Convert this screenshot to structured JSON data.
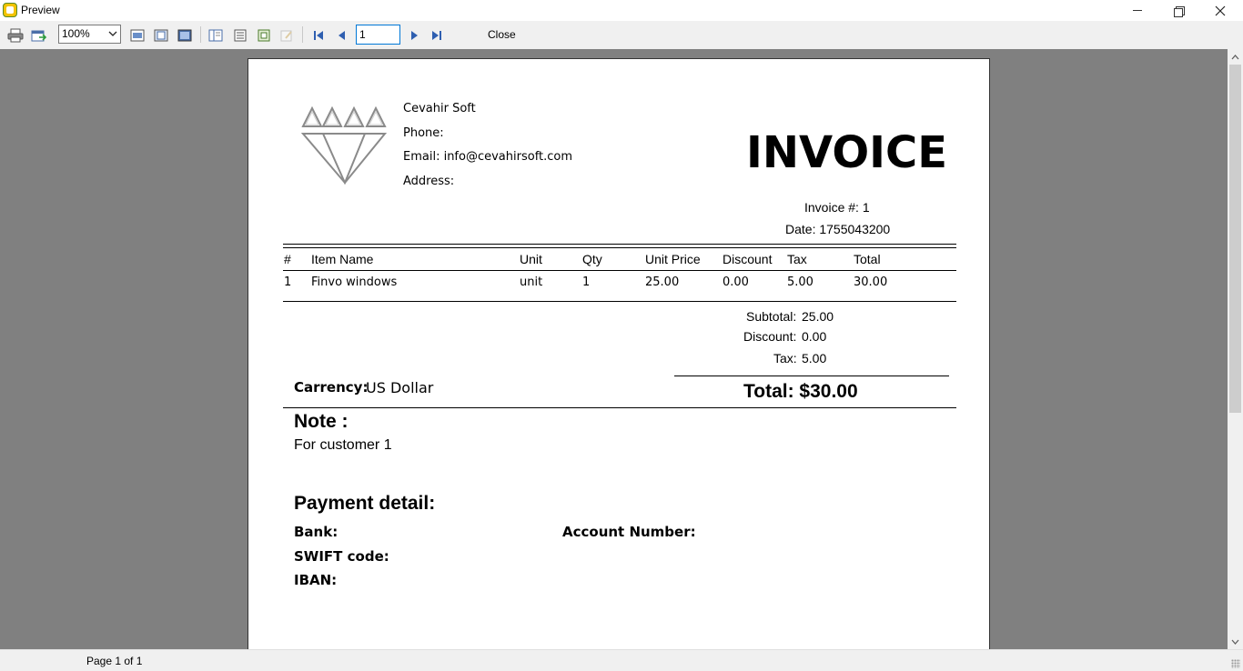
{
  "window": {
    "title": "Preview"
  },
  "toolbar": {
    "zoom_value": "100%",
    "page_value": "1",
    "close_label": "Close"
  },
  "status": {
    "page_info": "Page 1 of 1"
  },
  "invoice": {
    "company": {
      "name": "Cevahir Soft",
      "phone_line": "Phone:",
      "email_line": "Email: info@cevahirsoft.com",
      "address_line": "Address:"
    },
    "title": "INVOICE",
    "number_line": "Invoice #: 1",
    "date_line": "Date: 1755043200",
    "table": {
      "headers": [
        "#",
        "Item Name",
        "Unit",
        "Qty",
        "Unit Price",
        "Discount",
        "Tax",
        "Total"
      ],
      "rows": [
        [
          "1",
          "Finvo windows",
          "unit",
          "1",
          "25.00",
          "0.00",
          "5.00",
          "30.00"
        ]
      ]
    },
    "summary": {
      "subtotal_label": "Subtotal:",
      "subtotal_value": "25.00",
      "discount_label": "Discount:",
      "discount_value": "0.00",
      "tax_label": "Tax:",
      "tax_value": "5.00",
      "total_line": "Total: $30.00"
    },
    "currency": {
      "label": "Carrency:",
      "value": "US Dollar"
    },
    "note": {
      "title": "Note :",
      "text": "For customer 1"
    },
    "payment": {
      "title": "Payment detail:",
      "bank_label": "Bank:",
      "account_label": "Account Number:",
      "swift_label": "SWIFT code:",
      "iban_label": "IBAN:"
    }
  }
}
